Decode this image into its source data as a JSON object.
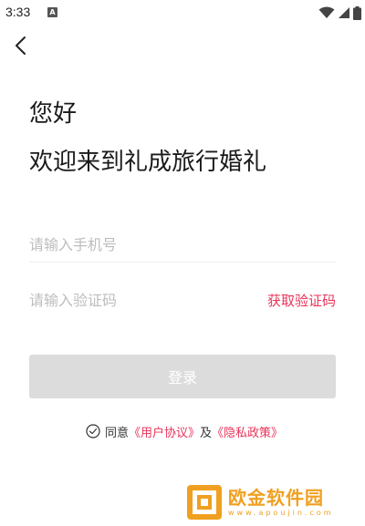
{
  "status_bar": {
    "time": "3:33",
    "notification_icon": "a-notification-icon",
    "icons": [
      "wifi-icon",
      "signal-icon",
      "battery-icon"
    ]
  },
  "nav": {
    "back_icon": "chevron-left-icon"
  },
  "heading": {
    "greeting": "您好",
    "welcome": "欢迎来到礼成旅行婚礼"
  },
  "form": {
    "phone_placeholder": "请输入手机号",
    "code_placeholder": "请输入验证码",
    "get_code_label": "获取验证码",
    "login_label": "登录"
  },
  "agreement": {
    "prefix": "同意",
    "user_agreement": "《用户协议》",
    "conjunction": "及",
    "privacy_policy": "《隐私政策》",
    "checked": false
  },
  "watermark": {
    "title": "欧金软件园",
    "url": "www.apoujin.com"
  },
  "colors": {
    "accent": "#e8335a",
    "button_disabled": "#dcdcdc",
    "placeholder": "#bdbdbd",
    "watermark": "#f0a020"
  }
}
